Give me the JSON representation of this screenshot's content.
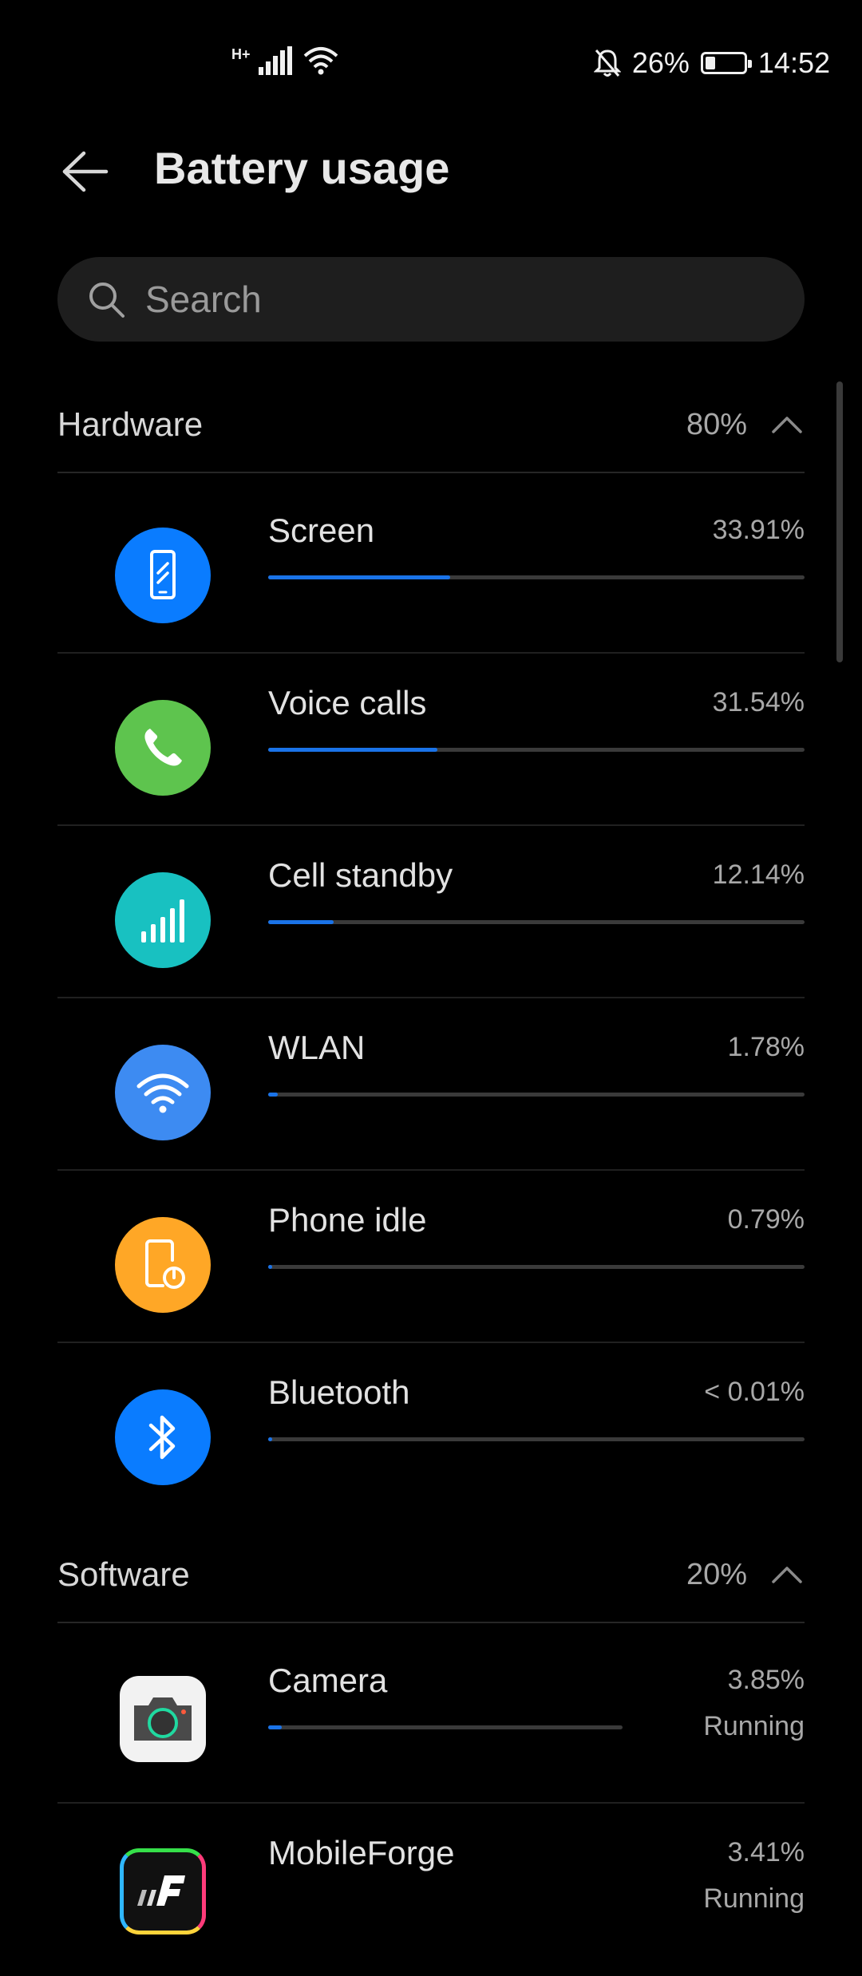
{
  "status_bar": {
    "network": "H+",
    "battery_percent": "26%",
    "battery_level": 0.26,
    "time": "14:52"
  },
  "header": {
    "title": "Battery usage"
  },
  "search": {
    "placeholder": "Search"
  },
  "hardware": {
    "title": "Hardware",
    "percent": "80%",
    "items": [
      {
        "label": "Screen",
        "percent": "33.91%",
        "value": 33.91,
        "icon": "phone-screen-icon",
        "color": "#0a7cff"
      },
      {
        "label": "Voice calls",
        "percent": "31.54%",
        "value": 31.54,
        "icon": "phone-call-icon",
        "color": "#5ec44e"
      },
      {
        "label": "Cell standby",
        "percent": "12.14%",
        "value": 12.14,
        "icon": "cell-signal-icon",
        "color": "#18c1c1"
      },
      {
        "label": "WLAN",
        "percent": "1.78%",
        "value": 1.78,
        "icon": "wifi-icon",
        "color": "#3d8bf2"
      },
      {
        "label": "Phone idle",
        "percent": "0.79%",
        "value": 0.79,
        "icon": "phone-idle-icon",
        "color": "#ffa726"
      },
      {
        "label": "Bluetooth",
        "percent": "< 0.01%",
        "value": 0.0,
        "icon": "bluetooth-icon",
        "color": "#0a7cff"
      }
    ]
  },
  "software": {
    "title": "Software",
    "percent": "20%",
    "items": [
      {
        "label": "Camera",
        "percent": "3.85%",
        "status": "Running",
        "value": 3.85,
        "icon": "camera-app-icon"
      },
      {
        "label": "MobileForge",
        "percent": "3.41%",
        "status": "Running",
        "value": 3.41,
        "icon": "mobileforge-app-icon"
      }
    ]
  }
}
